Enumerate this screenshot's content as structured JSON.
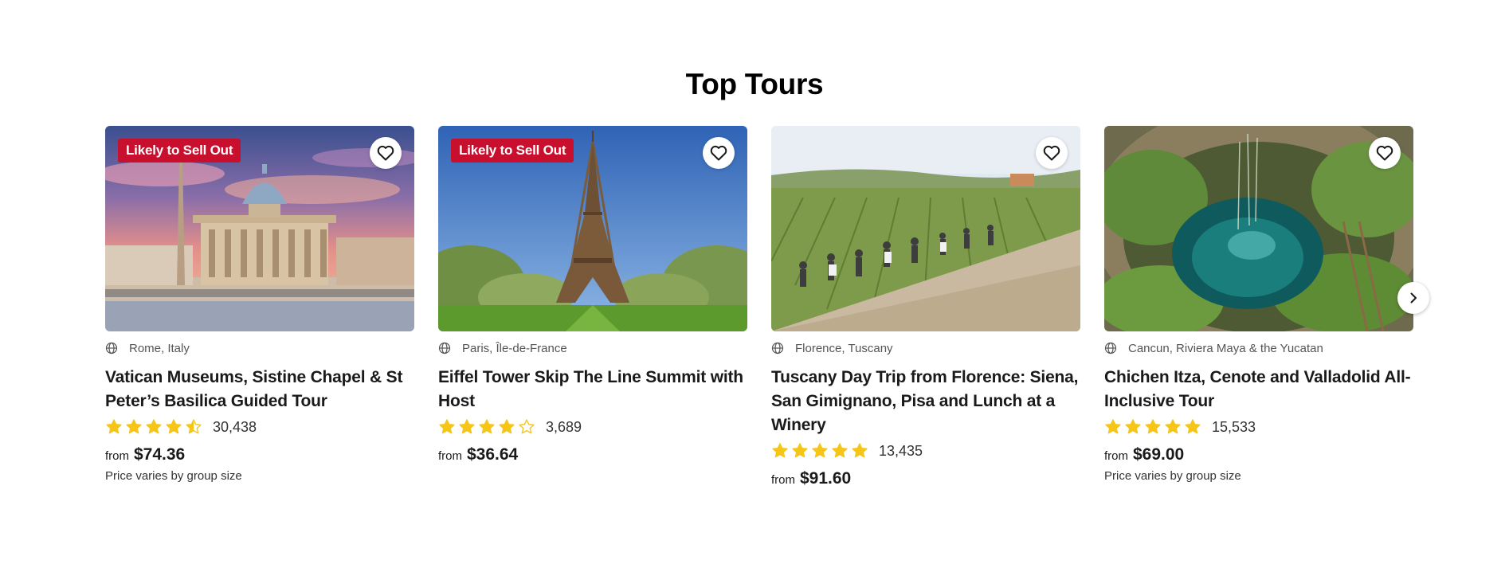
{
  "section": {
    "title": "Top Tours"
  },
  "tours": [
    {
      "badge": "Likely to Sell Out",
      "location": "Rome, Italy",
      "title": "Vatican Museums, Sistine Chapel & St Peter’s Basilica Guided Tour",
      "rating": 4.5,
      "reviews": "30,438",
      "from_label": "from",
      "price": "$74.36",
      "price_note": "Price varies by group size"
    },
    {
      "badge": "Likely to Sell Out",
      "location": "Paris, Île-de-France",
      "title": "Eiffel Tower Skip The Line Summit with Host",
      "rating": 4,
      "reviews": "3,689",
      "from_label": "from",
      "price": "$36.64",
      "price_note": ""
    },
    {
      "badge": "",
      "location": "Florence, Tuscany",
      "title": "Tuscany Day Trip from Florence: Siena, San Gimignano, Pisa and Lunch at a Winery",
      "rating": 5,
      "reviews": "13,435",
      "from_label": "from",
      "price": "$91.60",
      "price_note": ""
    },
    {
      "badge": "",
      "location": "Cancun, Riviera Maya & the Yucatan",
      "title": "Chichen Itza, Cenote and Valladolid All-Inclusive Tour",
      "rating": 5,
      "reviews": "15,533",
      "from_label": "from",
      "price": "$69.00",
      "price_note": "Price varies by group size"
    }
  ],
  "icons": {
    "favorite": "heart-icon",
    "location": "globe-icon",
    "rating": "star-icon",
    "next": "chevron-right-icon"
  },
  "colors": {
    "badge": "#c8102e",
    "star": "#f5c518",
    "star_empty_stroke": "#f5c518",
    "text": "#1a1a1a"
  }
}
